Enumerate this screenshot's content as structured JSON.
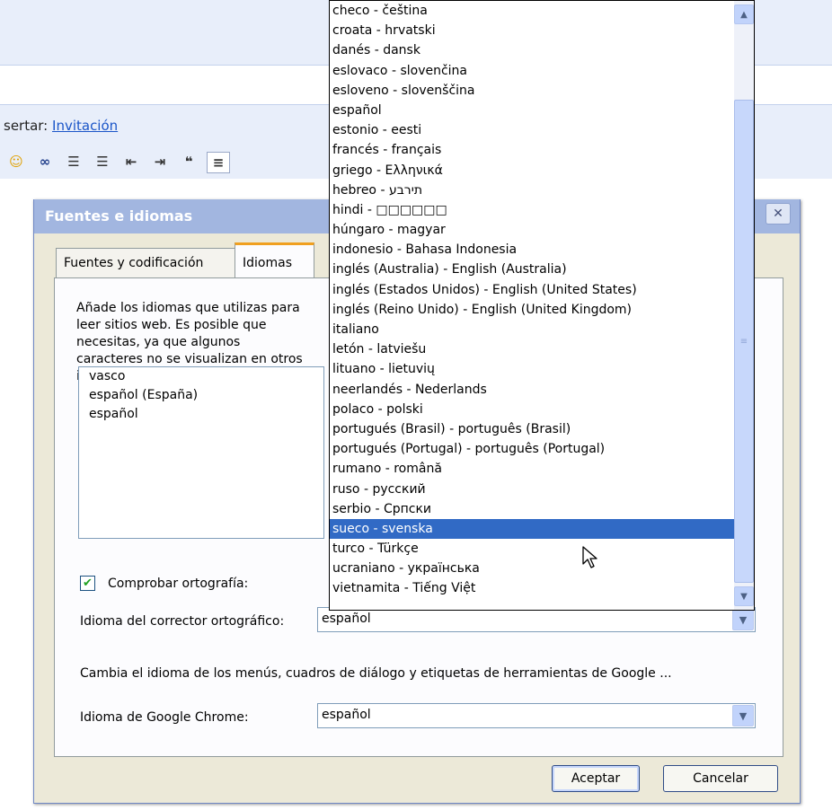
{
  "app": {
    "insert_label": "sertar: ",
    "insert_link": "Invitación"
  },
  "dialog": {
    "title": "Fuentes e idiomas",
    "tabs": [
      "Fuentes y codificación",
      "Idiomas"
    ],
    "description": "Añade los idiomas que utilizas para leer sitios web. Es posible que necesitas, ya que algunos caracteres no se visualizan en otros idiomas.",
    "languages": [
      "vasco",
      "español (España)",
      "español"
    ],
    "spellcheck_label": "Comprobar ortografía:",
    "spellcheck_checked": true,
    "corrector_label": "Idioma del corrector ortográfico:",
    "corrector_value": "español",
    "hint": "Cambia el idioma de los menús, cuadros de diálogo y etiquetas de herramientas de Google ...",
    "chrome_lang_label": "Idioma de Google Chrome:",
    "chrome_lang_value": "español",
    "ok_label": "Aceptar",
    "cancel_label": "Cancelar"
  },
  "dropdown": {
    "selected": "sueco - svenska",
    "items": [
      "checo - čeština",
      "croata - hrvatski",
      "danés - dansk",
      "eslovaco - slovenčina",
      "esloveno - slovenščina",
      "español",
      "estonio - eesti",
      "francés - français",
      "griego - Ελληνικά",
      "hebreo - תירבע",
      "hindi - □□□□□□",
      "húngaro - magyar",
      "indonesio - Bahasa Indonesia",
      "inglés (Australia) - English (Australia)",
      "inglés (Estados Unidos) - English (United States)",
      "inglés (Reino Unido) - English (United Kingdom)",
      "italiano",
      "letón - latviešu",
      "lituano - lietuvių",
      "neerlandés - Nederlands",
      "polaco - polski",
      "portugués (Brasil) - português (Brasil)",
      "portugués (Portugal) - português (Portugal)",
      "rumano - română",
      "ruso - русский",
      "serbio - Српски",
      "sueco - svenska",
      "turco - Türkçe",
      "ucraniano - українська",
      "vietnamita - Tiếng Việt"
    ]
  },
  "colors": {
    "selection": "#316ac5",
    "titlebar": "#a2b6e0",
    "dialog_bg": "#ece9d8"
  }
}
